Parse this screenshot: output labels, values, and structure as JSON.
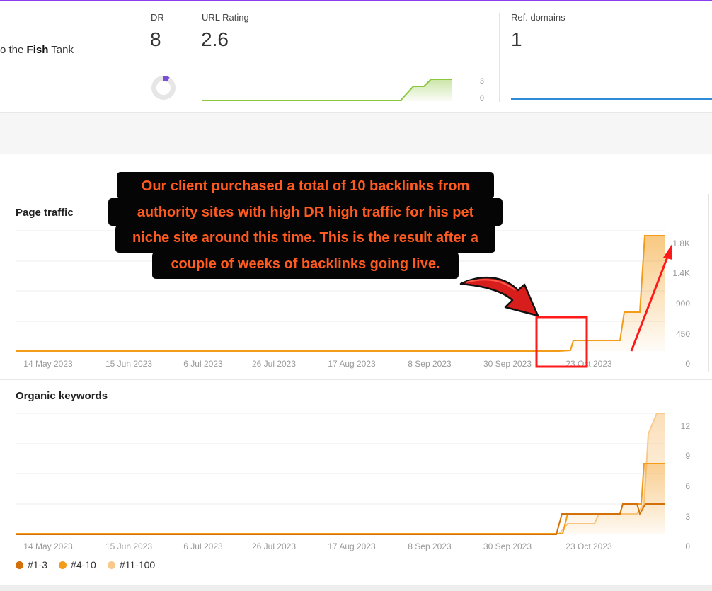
{
  "metrics": {
    "url_prefix": "o the ",
    "url_bold": "Fish",
    "url_suffix": " Tank",
    "dr": {
      "label": "DR",
      "value": "8"
    },
    "url_rating": {
      "label": "URL Rating",
      "value": "2.6",
      "axis_top": "3",
      "axis_bottom": "0"
    },
    "ref_domains": {
      "label": "Ref. domains",
      "value": "1"
    }
  },
  "colors": {
    "accent": "#8a3cf0",
    "traffic": "#f39c1a",
    "kw_top3": "#d3700a",
    "kw_4_10": "#f39c1a",
    "kw_11_100": "#f8c98a",
    "ur_green": "#8cc63f",
    "ref_blue": "#2f8ad8",
    "annotation": "#ff5a1f",
    "highlight": "#ff1a1a"
  },
  "annotation": {
    "lines": [
      "Our client purchased a total of 10 backlinks from",
      "authority sites with high DR high traffic for his pet",
      "niche site around this time. This is the result after a",
      "couple of weeks of backlinks going live."
    ]
  },
  "page_traffic": {
    "title": "Page traffic",
    "y_ticks": [
      "1.8K",
      "1.4K",
      "900",
      "450",
      "0"
    ],
    "x_ticks": [
      "14 May 2023",
      "15 Jun 2023",
      "6 Jul 2023",
      "26 Jul 2023",
      "17 Aug 2023",
      "8 Sep 2023",
      "30 Sep 2023",
      "23 Oct 2023"
    ]
  },
  "organic_keywords": {
    "title": "Organic keywords",
    "y_ticks": [
      "12",
      "9",
      "6",
      "3",
      "0"
    ],
    "x_ticks": [
      "14 May 2023",
      "15 Jun 2023",
      "6 Jul 2023",
      "26 Jul 2023",
      "17 Aug 2023",
      "8 Sep 2023",
      "30 Sep 2023",
      "23 Oct 2023"
    ],
    "legend": [
      "#1-3",
      "#4-10",
      "#11-100"
    ]
  }
}
